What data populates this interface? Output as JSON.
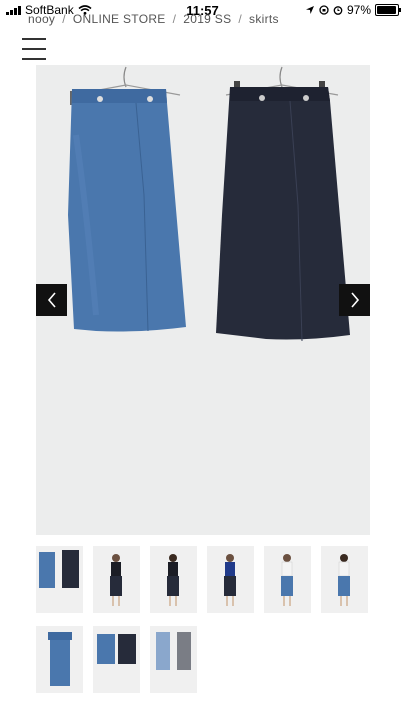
{
  "status_bar": {
    "carrier": "SoftBank",
    "time": "11:57",
    "battery": "97%"
  },
  "breadcrumb": {
    "items": [
      "nooy",
      "ONLINE STORE",
      "2019 SS",
      "skirts"
    ],
    "separator": "/"
  },
  "product": {
    "main_image": {
      "left_skirt_color": "#4a77ad",
      "right_skirt_color": "#262b3a",
      "background": "#eceded"
    }
  },
  "thumbnails": [
    {
      "id": 1,
      "type": "pair"
    },
    {
      "id": 2,
      "type": "model-navy"
    },
    {
      "id": 3,
      "type": "model-navy-back"
    },
    {
      "id": 4,
      "type": "model-navy-side"
    },
    {
      "id": 5,
      "type": "model-blue"
    },
    {
      "id": 6,
      "type": "model-blue-back"
    },
    {
      "id": 7,
      "type": "single-blue"
    },
    {
      "id": 8,
      "type": "pair-flat"
    },
    {
      "id": 9,
      "type": "pair-light"
    }
  ]
}
